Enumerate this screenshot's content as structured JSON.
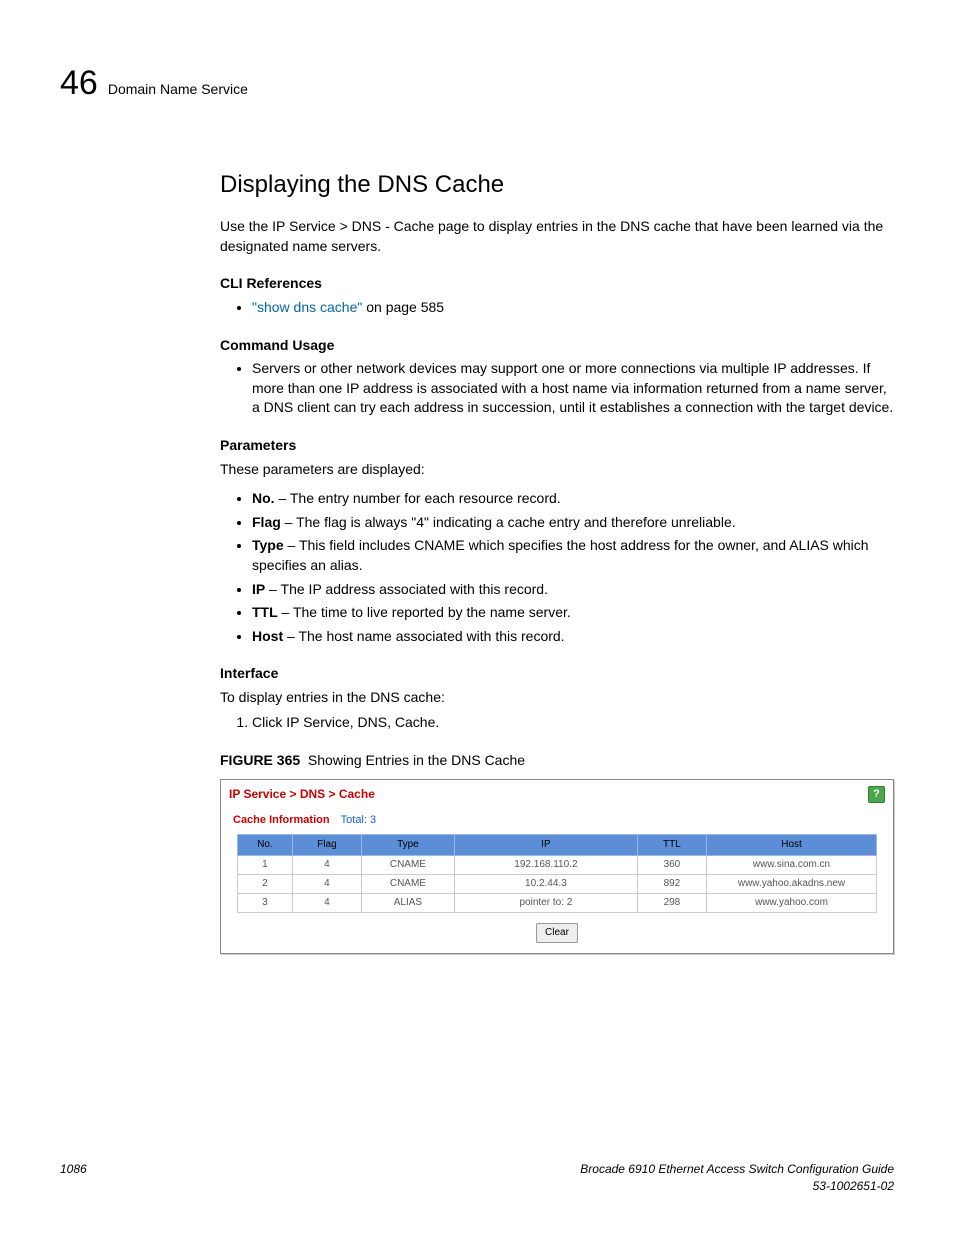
{
  "header": {
    "chapter_number": "46",
    "chapter_title": "Domain Name Service"
  },
  "section": {
    "title": "Displaying the DNS Cache",
    "intro": "Use the IP Service > DNS - Cache page to display entries in the DNS cache that have been learned via the designated name servers."
  },
  "cli_ref": {
    "heading": "CLI References",
    "link_text": "\"show dns cache\"",
    "suffix": " on page 585"
  },
  "usage": {
    "heading": "Command Usage",
    "item": "Servers or other network devices may support one or more connections via multiple IP addresses. If more than one IP address is associated with a host name via information returned from a name server, a DNS client can try each address in succession, until it establishes a connection with the target device."
  },
  "params": {
    "heading": "Parameters",
    "intro": "These parameters are displayed:",
    "items": [
      {
        "term": "No.",
        "desc": " – The entry number for each resource record."
      },
      {
        "term": "Flag",
        "desc": " – The flag is always \"4\" indicating a cache entry and therefore unreliable."
      },
      {
        "term": "Type",
        "desc": " – This field includes CNAME which specifies the host address for the owner, and ALIAS which specifies an alias."
      },
      {
        "term": "IP",
        "desc": " – The IP address associated with this record."
      },
      {
        "term": "TTL",
        "desc": " – The time to live reported by the name server."
      },
      {
        "term": "Host",
        "desc": " – The host name associated with this record."
      }
    ]
  },
  "interface": {
    "heading": "Interface",
    "intro": "To display entries in the DNS cache:",
    "step": "Click IP Service, DNS, Cache."
  },
  "figure": {
    "label": "FIGURE 365",
    "caption": "Showing Entries in the DNS Cache"
  },
  "screenshot": {
    "breadcrumb": "IP Service > DNS > Cache",
    "cache_label": "Cache Information",
    "cache_total": "Total: 3",
    "headers": {
      "no": "No.",
      "flag": "Flag",
      "type": "Type",
      "ip": "IP",
      "ttl": "TTL",
      "host": "Host"
    },
    "rows": [
      {
        "no": "1",
        "flag": "4",
        "type": "CNAME",
        "ip": "192.168.110.2",
        "ttl": "360",
        "host": "www.sina.com.cn"
      },
      {
        "no": "2",
        "flag": "4",
        "type": "CNAME",
        "ip": "10.2.44.3",
        "ttl": "892",
        "host": "www.yahoo.akadns.new"
      },
      {
        "no": "3",
        "flag": "4",
        "type": "ALIAS",
        "ip": "pointer to: 2",
        "ttl": "298",
        "host": "www.yahoo.com"
      }
    ],
    "clear_btn": "Clear"
  },
  "footer": {
    "page": "1086",
    "book": "Brocade 6910 Ethernet Access Switch Configuration Guide",
    "docnum": "53-1002651-02"
  }
}
